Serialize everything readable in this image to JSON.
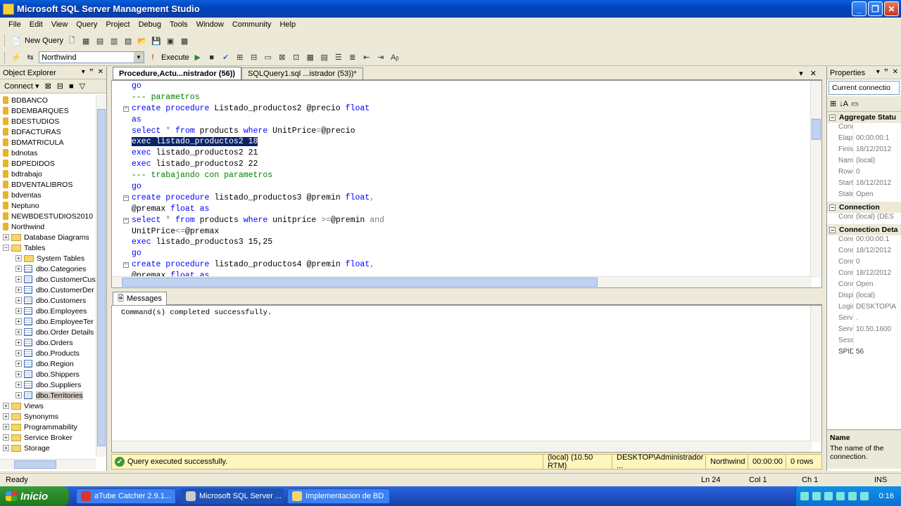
{
  "window": {
    "title": "Microsoft SQL Server Management Studio"
  },
  "menu": [
    "File",
    "Edit",
    "View",
    "Query",
    "Project",
    "Debug",
    "Tools",
    "Window",
    "Community",
    "Help"
  ],
  "toolbar": {
    "new_query": "New Query",
    "database": "Northwind",
    "execute": "Execute"
  },
  "object_explorer": {
    "title": "Object Explorer",
    "connect": "Connect ▾",
    "tree": [
      {
        "label": "BDBANCO",
        "type": "db",
        "level": 0
      },
      {
        "label": "BDEMBARQUES",
        "type": "db",
        "level": 0
      },
      {
        "label": "BDESTUDIOS",
        "type": "db",
        "level": 0
      },
      {
        "label": "BDFACTURAS",
        "type": "db",
        "level": 0
      },
      {
        "label": "BDMATRICULA",
        "type": "db",
        "level": 0
      },
      {
        "label": "bdnotas",
        "type": "db",
        "level": 0
      },
      {
        "label": "BDPEDIDOS",
        "type": "db",
        "level": 0
      },
      {
        "label": "bdtrabajo",
        "type": "db",
        "level": 0
      },
      {
        "label": "BDVENTALIBROS",
        "type": "db",
        "level": 0
      },
      {
        "label": "bdventas",
        "type": "db",
        "level": 0
      },
      {
        "label": "Neptuno",
        "type": "db",
        "level": 0
      },
      {
        "label": "NEWBDESTUDIOS2010",
        "type": "db",
        "level": 0
      },
      {
        "label": "Northwind",
        "type": "db",
        "level": 0
      },
      {
        "label": "Database Diagrams",
        "type": "folder",
        "level": 0,
        "exp": "+"
      },
      {
        "label": "Tables",
        "type": "folder",
        "level": 0,
        "exp": "−"
      },
      {
        "label": "System Tables",
        "type": "folder",
        "level": 1,
        "exp": "+"
      },
      {
        "label": "dbo.Categories",
        "type": "table",
        "level": 1,
        "exp": "+"
      },
      {
        "label": "dbo.CustomerCus",
        "type": "table",
        "level": 1,
        "exp": "+"
      },
      {
        "label": "dbo.CustomerDer",
        "type": "table",
        "level": 1,
        "exp": "+"
      },
      {
        "label": "dbo.Customers",
        "type": "table",
        "level": 1,
        "exp": "+"
      },
      {
        "label": "dbo.Employees",
        "type": "table",
        "level": 1,
        "exp": "+"
      },
      {
        "label": "dbo.EmployeeTer",
        "type": "table",
        "level": 1,
        "exp": "+"
      },
      {
        "label": "dbo.Order Details",
        "type": "table",
        "level": 1,
        "exp": "+"
      },
      {
        "label": "dbo.Orders",
        "type": "table",
        "level": 1,
        "exp": "+"
      },
      {
        "label": "dbo.Products",
        "type": "table",
        "level": 1,
        "exp": "+"
      },
      {
        "label": "dbo.Region",
        "type": "table",
        "level": 1,
        "exp": "+"
      },
      {
        "label": "dbo.Shippers",
        "type": "table",
        "level": 1,
        "exp": "+"
      },
      {
        "label": "dbo.Suppliers",
        "type": "table",
        "level": 1,
        "exp": "+"
      },
      {
        "label": "dbo.Territories",
        "type": "table",
        "level": 1,
        "exp": "+",
        "selected": true
      },
      {
        "label": "Views",
        "type": "folder",
        "level": 0,
        "exp": "+"
      },
      {
        "label": "Synonyms",
        "type": "folder",
        "level": 0,
        "exp": "+"
      },
      {
        "label": "Programmability",
        "type": "folder",
        "level": 0,
        "exp": "+"
      },
      {
        "label": "Service Broker",
        "type": "folder",
        "level": 0,
        "exp": "+"
      },
      {
        "label": "Storage",
        "type": "folder",
        "level": 0,
        "exp": "+"
      }
    ]
  },
  "editor": {
    "tabs": [
      {
        "label": "Procedure,Actu...nistrador (56))",
        "active": true
      },
      {
        "label": "SQLQuery1.sql ...istrador (53))*",
        "active": false
      }
    ],
    "lines": [
      {
        "fold": "",
        "parts": [
          [
            "kw",
            "go"
          ]
        ]
      },
      {
        "fold": "",
        "parts": [
          [
            "cm",
            "--- parametros"
          ]
        ]
      },
      {
        "fold": "−",
        "parts": [
          [
            "kw",
            "create procedure"
          ],
          [
            "plain",
            " Listado_productos2 @precio "
          ],
          [
            "kw",
            "float"
          ]
        ]
      },
      {
        "fold": "",
        "parts": [
          [
            "kw",
            "as"
          ]
        ]
      },
      {
        "fold": "",
        "parts": [
          [
            "kw",
            "select"
          ],
          [
            "op",
            " * "
          ],
          [
            "kw",
            "from"
          ],
          [
            "plain",
            " products "
          ],
          [
            "kw",
            "where"
          ],
          [
            "plain",
            " UnitPrice"
          ],
          [
            "op",
            "="
          ],
          [
            "plain",
            "@precio"
          ]
        ]
      },
      {
        "fold": "",
        "parts": [
          [
            "hl",
            "exec listado_productos2 18"
          ]
        ]
      },
      {
        "fold": "",
        "parts": [
          [
            "kw",
            "exec"
          ],
          [
            "plain",
            " listado_productos2 21"
          ]
        ]
      },
      {
        "fold": "",
        "parts": [
          [
            "kw",
            "exec"
          ],
          [
            "plain",
            " listado_productos2 22"
          ]
        ]
      },
      {
        "fold": "",
        "parts": [
          [
            "cm",
            "--- trabajando con parametros"
          ]
        ]
      },
      {
        "fold": "",
        "parts": [
          [
            "kw",
            "go"
          ]
        ]
      },
      {
        "fold": "−",
        "parts": [
          [
            "kw",
            "create procedure"
          ],
          [
            "plain",
            " listado_productos3 @premin "
          ],
          [
            "kw",
            "float"
          ],
          [
            "op",
            ","
          ]
        ]
      },
      {
        "fold": "",
        "parts": [
          [
            "plain",
            "@premax "
          ],
          [
            "kw",
            "float as"
          ]
        ]
      },
      {
        "fold": "−",
        "parts": [
          [
            "kw",
            "select"
          ],
          [
            "op",
            " * "
          ],
          [
            "kw",
            "from"
          ],
          [
            "plain",
            " products "
          ],
          [
            "kw",
            "where"
          ],
          [
            "plain",
            " unitprice "
          ],
          [
            "op",
            ">="
          ],
          [
            "plain",
            "@premin "
          ],
          [
            "op",
            "and"
          ]
        ]
      },
      {
        "fold": "",
        "parts": [
          [
            "plain",
            "UnitPrice"
          ],
          [
            "op",
            "<="
          ],
          [
            "plain",
            "@premax"
          ]
        ]
      },
      {
        "fold": "",
        "parts": [
          [
            "kw",
            "exec"
          ],
          [
            "plain",
            " listado_productos3 15,25"
          ]
        ]
      },
      {
        "fold": "",
        "parts": [
          [
            "kw",
            "go"
          ]
        ]
      },
      {
        "fold": "−",
        "parts": [
          [
            "kw",
            "create procedure"
          ],
          [
            "plain",
            " listado_productos4 @premin "
          ],
          [
            "kw",
            "float"
          ],
          [
            "op",
            ","
          ]
        ]
      },
      {
        "fold": "",
        "parts": [
          [
            "plain",
            "@premax "
          ],
          [
            "kw",
            "float as"
          ]
        ]
      }
    ]
  },
  "results": {
    "tab": "Messages",
    "message": "Command(s) completed successfully."
  },
  "query_status": {
    "message": "Query executed successfully.",
    "server": "(local) (10.50 RTM)",
    "user": "DESKTOP\\Administrador ...",
    "database": "Northwind",
    "time": "00:00:00",
    "rows": "0 rows"
  },
  "properties": {
    "title": "Properties",
    "combo": "Current connectio",
    "sections": [
      {
        "name": "Aggregate Statu",
        "rows": [
          [
            "Connec",
            ""
          ],
          [
            "Elapsec",
            "00:00:00.1"
          ],
          [
            "Finish t",
            "18/12/2012"
          ],
          [
            "Name",
            "(local)"
          ],
          [
            "Rows r",
            "0"
          ],
          [
            "Start ti",
            "18/12/2012"
          ],
          [
            "State",
            "Open"
          ]
        ]
      },
      {
        "name": "Connection",
        "rows": [
          [
            "Connec",
            "(local) (DES"
          ]
        ]
      },
      {
        "name": "Connection Deta",
        "rows": [
          [
            "Connec",
            "00:00:00.1"
          ],
          [
            "Connec",
            "18/12/2012"
          ],
          [
            "Connec",
            "0"
          ],
          [
            "Connec",
            "18/12/2012"
          ],
          [
            "Connec",
            "Open"
          ],
          [
            "Display",
            "(local)"
          ],
          [
            "Login n",
            "DESKTOP\\A"
          ],
          [
            "Server",
            "."
          ],
          [
            "Server",
            "10.50.1600"
          ],
          [
            "Sessior",
            ""
          ],
          [
            "SPID",
            "56"
          ]
        ]
      }
    ],
    "desc_title": "Name",
    "desc_text": "The name of the connection."
  },
  "statusbar": {
    "ready": "Ready",
    "ln": "Ln 24",
    "col": "Col 1",
    "ch": "Ch 1",
    "mode": "INS"
  },
  "taskbar": {
    "start": "Inicio",
    "buttons": [
      "aTube Catcher 2.9.1...",
      "Microsoft SQL Server ...",
      "Implementacion de BD"
    ],
    "clock": "0:16"
  }
}
